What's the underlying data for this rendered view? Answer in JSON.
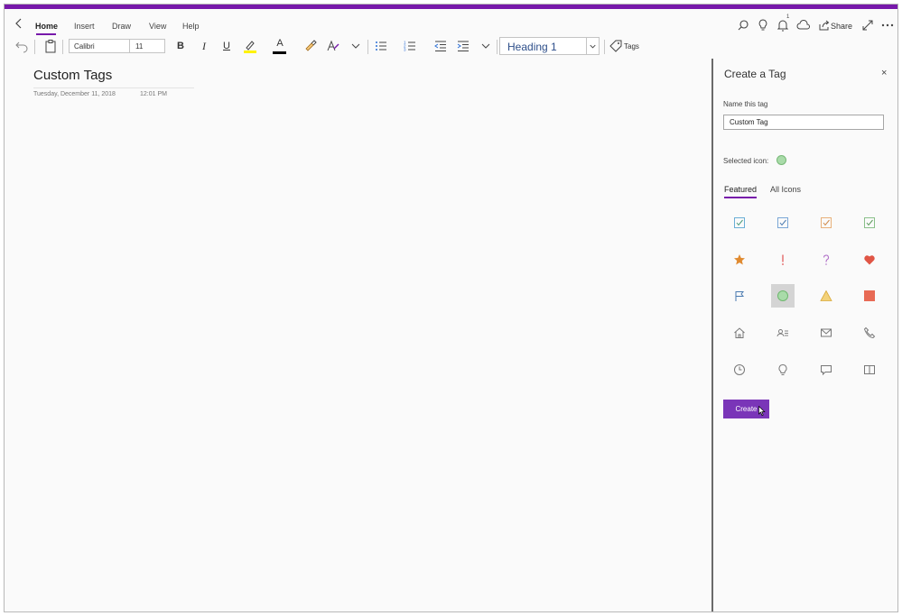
{
  "menu": {
    "tabs": [
      {
        "label": "Home",
        "active": true
      },
      {
        "label": "Insert",
        "active": false
      },
      {
        "label": "Draw",
        "active": false
      },
      {
        "label": "View",
        "active": false
      },
      {
        "label": "Help",
        "active": false
      }
    ],
    "notification_count": "1",
    "share_label": "Share"
  },
  "toolbar": {
    "font_name": "Calibri",
    "font_size": "11",
    "bold": "B",
    "italic": "I",
    "underline": "U",
    "font_color_glyph": "A",
    "style": "Heading 1",
    "tags_label": "Tags",
    "highlight_color": "#fff200",
    "font_color": "#000000"
  },
  "page": {
    "title": "Custom Tags",
    "date": "Tuesday, December 11, 2018",
    "time": "12:01 PM"
  },
  "panel": {
    "title": "Create a Tag",
    "close_glyph": "×",
    "name_label": "Name this tag",
    "name_value": "Custom Tag",
    "selected_label": "Selected icon:",
    "tabs": [
      "Featured",
      "All Icons"
    ],
    "create_label": "Create",
    "icons": [
      "checkbox-teal-icon",
      "checkbox-blue-icon",
      "checkbox-orange-icon",
      "checkbox-green-icon",
      "star-icon",
      "exclamation-icon",
      "question-icon",
      "heart-icon",
      "flag-icon",
      "circle-green-icon",
      "triangle-yellow-icon",
      "square-red-icon",
      "home-icon",
      "contact-icon",
      "mail-icon",
      "phone-icon",
      "clock-icon",
      "lightbulb-icon",
      "comment-icon",
      "book-icon"
    ],
    "selected_icon": "circle-green-icon"
  },
  "colors": {
    "accent": "#7719aa",
    "create_button": "#7a35b8"
  }
}
